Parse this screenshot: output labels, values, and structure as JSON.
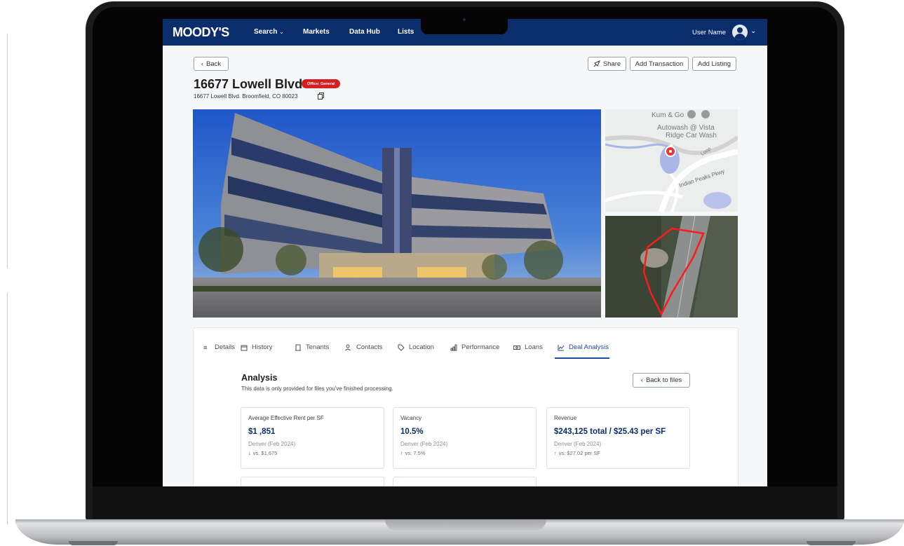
{
  "nav": {
    "logo": "MOODY'S",
    "items": [
      {
        "label": "Search",
        "has_dropdown": true
      },
      {
        "label": "Markets"
      },
      {
        "label": "Data Hub"
      },
      {
        "label": "Lists"
      }
    ],
    "user_name": "User Name"
  },
  "actions": {
    "back": "Back",
    "share": "Share",
    "add_transaction": "Add Transaction",
    "add_listing": "Add Listing"
  },
  "property": {
    "title": "16677 Lowell Blvd",
    "badge": "Office: General",
    "address": "16677 Lowell Blvd. Broomfield, CO 80023"
  },
  "map": {
    "labels": [
      "Kum & Go",
      "Autowash @ Vista",
      "Ridge Car Wash",
      "Indian Peaks Pkwy",
      "Loop"
    ]
  },
  "tabs": [
    {
      "label": "Details",
      "icon": "list-icon"
    },
    {
      "label": "History",
      "icon": "calendar-icon"
    },
    {
      "label": "Tenants",
      "icon": "building-icon"
    },
    {
      "label": "Contacts",
      "icon": "people-icon"
    },
    {
      "label": "Location",
      "icon": "tag-icon"
    },
    {
      "label": "Performance",
      "icon": "bar-chart-icon"
    },
    {
      "label": "Loans",
      "icon": "money-icon"
    },
    {
      "label": "Deal Analysis",
      "icon": "line-chart-icon",
      "active": true
    }
  ],
  "analysis": {
    "title": "Analysis",
    "subtitle": "This data is only provided for files you've finished processing.",
    "back_to_files": "Back to files",
    "metrics": [
      {
        "label": "Average Effective Rent per SF",
        "value": "$1 ,851",
        "region": "Denver (Feb 2024)",
        "direction": "down",
        "compare": "vs. $1,675"
      },
      {
        "label": "Vacancy",
        "value": "10.5%",
        "region": "Denver (Feb 2024)",
        "direction": "up",
        "compare": "vs. 7.5%"
      },
      {
        "label": "Revenue",
        "value": "$243,125 total / $25.43 per SF",
        "region": "Denver (Feb 2024)",
        "direction": "up",
        "compare": "vs. $27.02 per SF"
      }
    ]
  },
  "colors": {
    "nav_bg": "#0b2d6b",
    "accent": "#1d4ea0",
    "badge": "#d32020",
    "down": "#d32020",
    "up": "#2a8a3c"
  }
}
